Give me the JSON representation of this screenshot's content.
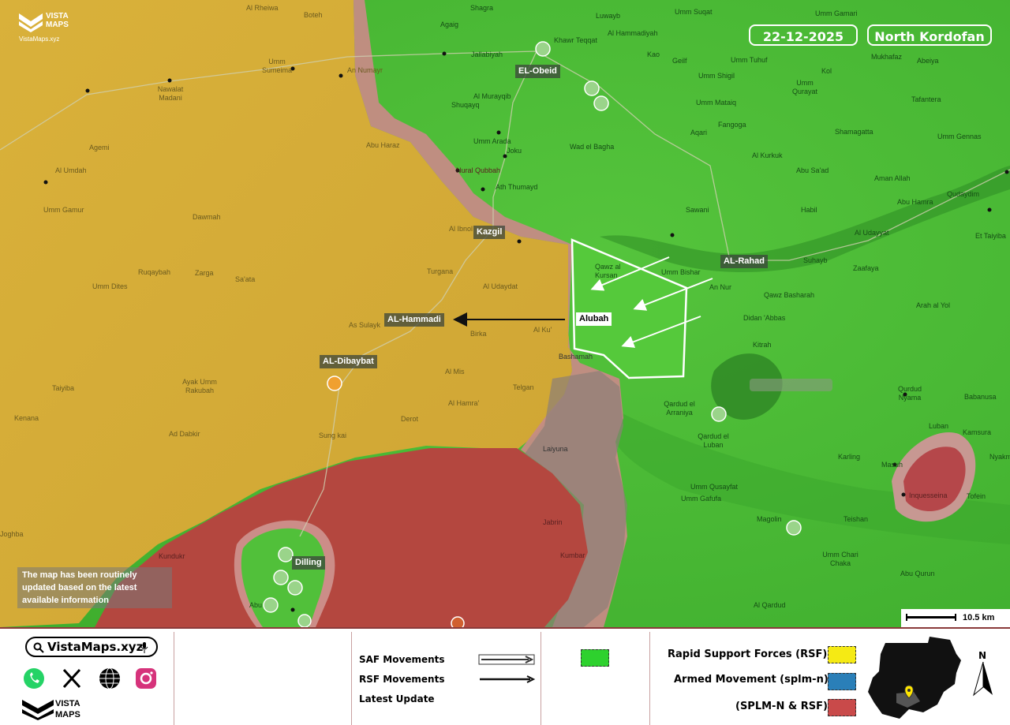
{
  "brand": {
    "name_line1": "VISTA",
    "name_line2": "MAPS",
    "site": "VistaMaps.xyz"
  },
  "header": {
    "date": "22-12-2025",
    "region": "North Kordofan"
  },
  "notice": "The map has been routinely updated based on the latest available information",
  "scale": {
    "label": "10.5 km"
  },
  "plates": {
    "el_obeid": "EL-Obeid",
    "kazgil": "Kazgil",
    "al_rahad": "AL-Rahad",
    "alubah": "Alubah",
    "al_hammadi": "AL-Hammadi",
    "al_dibaybat": "AL-Dibaybat",
    "dilling": "Dilling"
  },
  "places": [
    {
      "id": "al_rheiwa",
      "text": "Al Rheiwa"
    },
    {
      "id": "boteh",
      "text": "Boteh"
    },
    {
      "id": "shagra",
      "text": "Shagra"
    },
    {
      "id": "luwayb",
      "text": "Luwayb"
    },
    {
      "id": "umm_sugat",
      "text": "Umm Suqat"
    },
    {
      "id": "umm_gamari",
      "text": "Umm Gamari"
    },
    {
      "id": "agaig",
      "text": "Agaig"
    },
    {
      "id": "khawr_tegat",
      "text": "Khawr Teqqat"
    },
    {
      "id": "al_hammadiyah",
      "text": "Al Hammadiyah"
    },
    {
      "id": "jallabiyah",
      "text": "Jallabiyah"
    },
    {
      "id": "umm_sumeima",
      "text": "Umm Sumeima"
    },
    {
      "id": "an_numayr",
      "text": "An Numayr"
    },
    {
      "id": "kao",
      "text": "Kao"
    },
    {
      "id": "geilf",
      "text": "Geilf"
    },
    {
      "id": "umm_tuhuf",
      "text": "Umm Tuhuf"
    },
    {
      "id": "mukhafaz",
      "text": "Mukhafaz"
    },
    {
      "id": "abeiya",
      "text": "Abeiya"
    },
    {
      "id": "nawalat_madani",
      "text": "Nawalat Madani"
    },
    {
      "id": "al_murayqib",
      "text": "Al Murayqib"
    },
    {
      "id": "umm_shigil",
      "text": "Umm Shigil"
    },
    {
      "id": "kol",
      "text": "Kol"
    },
    {
      "id": "umm_qurayat",
      "text": "Umm Qurayat"
    },
    {
      "id": "shuqayq",
      "text": "Shuqayq"
    },
    {
      "id": "umm_mataiq",
      "text": "Umm Mataiq"
    },
    {
      "id": "tafantera",
      "text": "Tafantera"
    },
    {
      "id": "umm_arada",
      "text": "Umm Arada"
    },
    {
      "id": "aqari",
      "text": "Aqari"
    },
    {
      "id": "fangoga",
      "text": "Fangoga"
    },
    {
      "id": "shamagatta",
      "text": "Shamagatta"
    },
    {
      "id": "umm_gennas",
      "text": "Umm Gennas"
    },
    {
      "id": "agemi",
      "text": "Agemi"
    },
    {
      "id": "abu_haraz",
      "text": "Abu Haraz"
    },
    {
      "id": "joku",
      "text": "Joku"
    },
    {
      "id": "wad_el_bagha",
      "text": "Wad el Bagha"
    },
    {
      "id": "al_kurkuk",
      "text": "Al Kurkuk"
    },
    {
      "id": "al_umdah",
      "text": "Al Umdah"
    },
    {
      "id": "nural_qubbah",
      "text": "Nural Qubbah"
    },
    {
      "id": "abu_sad",
      "text": "Abu Sa'ad"
    },
    {
      "id": "aman_allah",
      "text": "Aman Allah"
    },
    {
      "id": "ath_thumayd",
      "text": "Ath Thumayd"
    },
    {
      "id": "qudaydim",
      "text": "Qudaydim"
    },
    {
      "id": "umm_gamur",
      "text": "Umm Gamur"
    },
    {
      "id": "abu_hamra",
      "text": "Abu Hamra"
    },
    {
      "id": "sawani",
      "text": "Sawani"
    },
    {
      "id": "habil",
      "text": "Habil"
    },
    {
      "id": "dawmah",
      "text": "Dawmah"
    },
    {
      "id": "al_ibnol",
      "text": "Al Ibnol"
    },
    {
      "id": "al_udayyat",
      "text": "Al Udayyat"
    },
    {
      "id": "et_taiyiba",
      "text": "Et Taiyiba"
    },
    {
      "id": "qawz_al_kursan",
      "text": "Qawz al Kursan"
    },
    {
      "id": "umm_bishar",
      "text": "Umm Bishar"
    },
    {
      "id": "suhayb",
      "text": "Suhayb"
    },
    {
      "id": "zaafaya",
      "text": "Zaafaya"
    },
    {
      "id": "ruqaybah",
      "text": "Ruqaybah"
    },
    {
      "id": "zarga",
      "text": "Zarga"
    },
    {
      "id": "sa_ata",
      "text": "Sa'ata"
    },
    {
      "id": "turgana",
      "text": "Turgana"
    },
    {
      "id": "an_nur",
      "text": "An Nur"
    },
    {
      "id": "umm_dites",
      "text": "Umm Dites"
    },
    {
      "id": "al_udaydat",
      "text": "Al Udaydat"
    },
    {
      "id": "qawz_basharah",
      "text": "Qawz Basharah"
    },
    {
      "id": "arah_al_yol",
      "text": "Arah al Yol"
    },
    {
      "id": "as_sulayk",
      "text": "As Sulayk"
    },
    {
      "id": "birka",
      "text": "Birka"
    },
    {
      "id": "al_ku",
      "text": "Al Ku'"
    },
    {
      "id": "didan_abbas",
      "text": "Didan 'Abbas"
    },
    {
      "id": "kitrah",
      "text": "Kitrah"
    },
    {
      "id": "bashamah",
      "text": "Bashamah"
    },
    {
      "id": "taiyiba",
      "text": "Taiyiba"
    },
    {
      "id": "ayak_umm_rakubah",
      "text": "Ayak Umm Rakubah"
    },
    {
      "id": "al_mis",
      "text": "Al Mis"
    },
    {
      "id": "telgan",
      "text": "Telgan"
    },
    {
      "id": "qurdud_nyama",
      "text": "Qurdud Nyama"
    },
    {
      "id": "qardud_el_arraniya",
      "text": "Qardud el Arraniya"
    },
    {
      "id": "al_hamra",
      "text": "Al Hamra'"
    },
    {
      "id": "babanusa",
      "text": "Babanusa"
    },
    {
      "id": "kenana",
      "text": "Kenana"
    },
    {
      "id": "derot",
      "text": "Derot"
    },
    {
      "id": "ad_dabkir",
      "text": "Ad Dabkir"
    },
    {
      "id": "sungkai",
      "text": "Sung kai"
    },
    {
      "id": "qardud_el_luban",
      "text": "Qardud el Luban"
    },
    {
      "id": "laiyuna",
      "text": "Laiyuna"
    },
    {
      "id": "luban",
      "text": "Luban"
    },
    {
      "id": "kamsura",
      "text": "Kamsura"
    },
    {
      "id": "karling",
      "text": "Karling"
    },
    {
      "id": "masuh",
      "text": "Masuh"
    },
    {
      "id": "nyakma",
      "text": "Nyakm"
    },
    {
      "id": "umm_qusayfat",
      "text": "Umm Qusayfat"
    },
    {
      "id": "umm_gafufa",
      "text": "Umm Gafufa"
    },
    {
      "id": "inquesseina",
      "text": "Inquesseina"
    },
    {
      "id": "tofein",
      "text": "Tofein"
    },
    {
      "id": "jabrin",
      "text": "Jabrin"
    },
    {
      "id": "magolin",
      "text": "Magolin"
    },
    {
      "id": "teishan",
      "text": "Teishan"
    },
    {
      "id": "joghba",
      "text": "Joghba"
    },
    {
      "id": "kundukr",
      "text": "Kundukr"
    },
    {
      "id": "kumbar",
      "text": "Kumbar"
    },
    {
      "id": "umm_chaka",
      "text": "Umm Chari Chaka"
    },
    {
      "id": "abu_qurun",
      "text": "Abu Qurun"
    },
    {
      "id": "al_qardud",
      "text": "Al Qardud"
    },
    {
      "id": "abu",
      "text": "Abu"
    }
  ],
  "footer": {
    "site_box": "VistaMaps.xyz",
    "brand_line1": "VISTA",
    "brand_line2": "MAPS",
    "legend_movements": [
      {
        "label": "SAF Movements"
      },
      {
        "label": "RSF Movements"
      },
      {
        "label": "Latest Update"
      }
    ],
    "legend_forces": [
      {
        "label": "Rapid Support Forces (RSF)",
        "color": "#f5ea14"
      },
      {
        "label": "Armed Movement (splm-n)",
        "color": "#2a7fb8"
      },
      {
        "label": "(SPLM-N & RSF)",
        "color": "#c94a4a"
      }
    ],
    "saf_color": "#2ed12e",
    "compass": "N"
  },
  "colors": {
    "rsf": "#d4ae3a",
    "saf": "#4fc237",
    "joint": "#b84a4a",
    "contested": "#c9908a"
  }
}
